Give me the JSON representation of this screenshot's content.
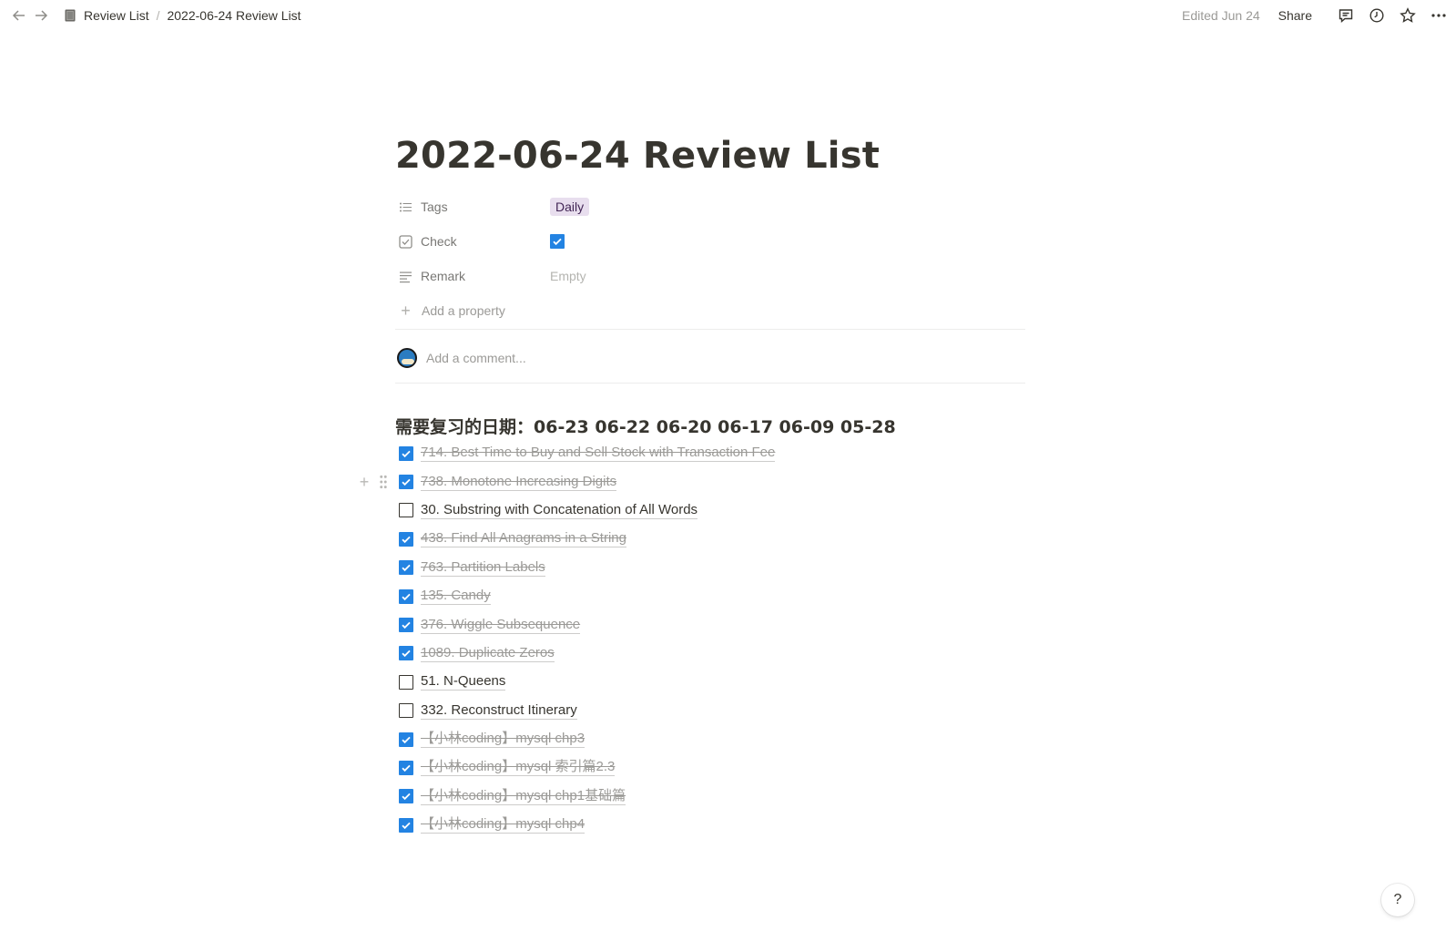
{
  "topbar": {
    "breadcrumb": [
      {
        "label": "Review List",
        "icon": "notebook-icon"
      },
      {
        "label": "2022-06-24 Review List"
      }
    ],
    "separator": "/",
    "edited": "Edited Jun 24",
    "share_label": "Share",
    "icons": [
      "back-arrow-icon",
      "forward-arrow-icon",
      "comment-icon",
      "history-clock-icon",
      "star-icon",
      "more-icon"
    ]
  },
  "page": {
    "title": "2022-06-24 Review List",
    "properties": {
      "tags": {
        "name": "Tags",
        "value": "Daily",
        "color": "#e8deee"
      },
      "check": {
        "name": "Check",
        "checked": true
      },
      "remark": {
        "name": "Remark",
        "value": "Empty"
      }
    },
    "add_property": "Add a property",
    "comment_placeholder": "Add a comment...",
    "heading": "需要复习的日期：06-23 06-22 06-20 06-17 06-09 05-28",
    "todos": [
      {
        "text": "714. Best Time to Buy and Sell Stock with Transaction Fee",
        "checked": true
      },
      {
        "text": "738. Monotone Increasing Digits",
        "checked": true
      },
      {
        "text": "30. Substring with Concatenation of All Words",
        "checked": false
      },
      {
        "text": "438. Find All Anagrams in a String",
        "checked": true
      },
      {
        "text": "763. Partition Labels",
        "checked": true
      },
      {
        "text": "135. Candy",
        "checked": true
      },
      {
        "text": "376. Wiggle Subsequence",
        "checked": true
      },
      {
        "text": "1089. Duplicate Zeros",
        "checked": true
      },
      {
        "text": "51. N-Queens",
        "checked": false
      },
      {
        "text": "332. Reconstruct Itinerary",
        "checked": false
      },
      {
        "text": "【小林coding】mysql chp3",
        "checked": true
      },
      {
        "text": "【小林coding】mysql 索引篇2.3",
        "checked": true
      },
      {
        "text": "【小林coding】mysql chp1基础篇",
        "checked": true
      },
      {
        "text": "【小林coding】mysql chp4",
        "checked": true
      }
    ]
  },
  "help_label": "?",
  "colors": {
    "accent": "#2383e2",
    "text": "#37352f",
    "muted": "#9b9a97"
  }
}
